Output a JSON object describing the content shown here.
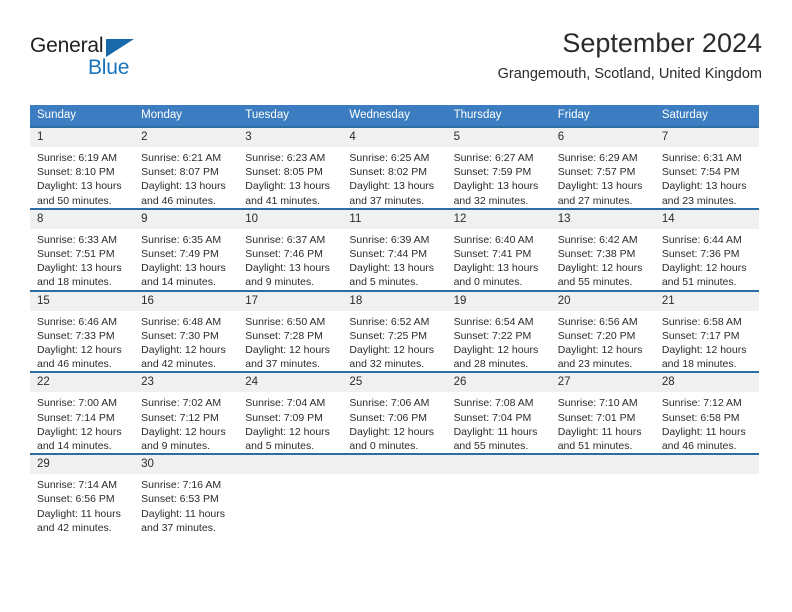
{
  "brand": {
    "name_part1": "General",
    "name_part2": "Blue",
    "color_dark": "#231f20",
    "color_blue": "#1b75bc"
  },
  "header": {
    "month_title": "September 2024",
    "location": "Grangemouth, Scotland, United Kingdom"
  },
  "theme": {
    "header_bar": "#3b7dc0",
    "week_rule": "#2e6da4",
    "daynum_band": "#f0f0f0",
    "text": "#2b2b2b"
  },
  "weekday_headers": [
    "Sunday",
    "Monday",
    "Tuesday",
    "Wednesday",
    "Thursday",
    "Friday",
    "Saturday"
  ],
  "weeks": [
    [
      {
        "day": "1",
        "sunrise": "Sunrise: 6:19 AM",
        "sunset": "Sunset: 8:10 PM",
        "daylight_l1": "Daylight: 13 hours",
        "daylight_l2": "and 50 minutes."
      },
      {
        "day": "2",
        "sunrise": "Sunrise: 6:21 AM",
        "sunset": "Sunset: 8:07 PM",
        "daylight_l1": "Daylight: 13 hours",
        "daylight_l2": "and 46 minutes."
      },
      {
        "day": "3",
        "sunrise": "Sunrise: 6:23 AM",
        "sunset": "Sunset: 8:05 PM",
        "daylight_l1": "Daylight: 13 hours",
        "daylight_l2": "and 41 minutes."
      },
      {
        "day": "4",
        "sunrise": "Sunrise: 6:25 AM",
        "sunset": "Sunset: 8:02 PM",
        "daylight_l1": "Daylight: 13 hours",
        "daylight_l2": "and 37 minutes."
      },
      {
        "day": "5",
        "sunrise": "Sunrise: 6:27 AM",
        "sunset": "Sunset: 7:59 PM",
        "daylight_l1": "Daylight: 13 hours",
        "daylight_l2": "and 32 minutes."
      },
      {
        "day": "6",
        "sunrise": "Sunrise: 6:29 AM",
        "sunset": "Sunset: 7:57 PM",
        "daylight_l1": "Daylight: 13 hours",
        "daylight_l2": "and 27 minutes."
      },
      {
        "day": "7",
        "sunrise": "Sunrise: 6:31 AM",
        "sunset": "Sunset: 7:54 PM",
        "daylight_l1": "Daylight: 13 hours",
        "daylight_l2": "and 23 minutes."
      }
    ],
    [
      {
        "day": "8",
        "sunrise": "Sunrise: 6:33 AM",
        "sunset": "Sunset: 7:51 PM",
        "daylight_l1": "Daylight: 13 hours",
        "daylight_l2": "and 18 minutes."
      },
      {
        "day": "9",
        "sunrise": "Sunrise: 6:35 AM",
        "sunset": "Sunset: 7:49 PM",
        "daylight_l1": "Daylight: 13 hours",
        "daylight_l2": "and 14 minutes."
      },
      {
        "day": "10",
        "sunrise": "Sunrise: 6:37 AM",
        "sunset": "Sunset: 7:46 PM",
        "daylight_l1": "Daylight: 13 hours",
        "daylight_l2": "and 9 minutes."
      },
      {
        "day": "11",
        "sunrise": "Sunrise: 6:39 AM",
        "sunset": "Sunset: 7:44 PM",
        "daylight_l1": "Daylight: 13 hours",
        "daylight_l2": "and 5 minutes."
      },
      {
        "day": "12",
        "sunrise": "Sunrise: 6:40 AM",
        "sunset": "Sunset: 7:41 PM",
        "daylight_l1": "Daylight: 13 hours",
        "daylight_l2": "and 0 minutes."
      },
      {
        "day": "13",
        "sunrise": "Sunrise: 6:42 AM",
        "sunset": "Sunset: 7:38 PM",
        "daylight_l1": "Daylight: 12 hours",
        "daylight_l2": "and 55 minutes."
      },
      {
        "day": "14",
        "sunrise": "Sunrise: 6:44 AM",
        "sunset": "Sunset: 7:36 PM",
        "daylight_l1": "Daylight: 12 hours",
        "daylight_l2": "and 51 minutes."
      }
    ],
    [
      {
        "day": "15",
        "sunrise": "Sunrise: 6:46 AM",
        "sunset": "Sunset: 7:33 PM",
        "daylight_l1": "Daylight: 12 hours",
        "daylight_l2": "and 46 minutes."
      },
      {
        "day": "16",
        "sunrise": "Sunrise: 6:48 AM",
        "sunset": "Sunset: 7:30 PM",
        "daylight_l1": "Daylight: 12 hours",
        "daylight_l2": "and 42 minutes."
      },
      {
        "day": "17",
        "sunrise": "Sunrise: 6:50 AM",
        "sunset": "Sunset: 7:28 PM",
        "daylight_l1": "Daylight: 12 hours",
        "daylight_l2": "and 37 minutes."
      },
      {
        "day": "18",
        "sunrise": "Sunrise: 6:52 AM",
        "sunset": "Sunset: 7:25 PM",
        "daylight_l1": "Daylight: 12 hours",
        "daylight_l2": "and 32 minutes."
      },
      {
        "day": "19",
        "sunrise": "Sunrise: 6:54 AM",
        "sunset": "Sunset: 7:22 PM",
        "daylight_l1": "Daylight: 12 hours",
        "daylight_l2": "and 28 minutes."
      },
      {
        "day": "20",
        "sunrise": "Sunrise: 6:56 AM",
        "sunset": "Sunset: 7:20 PM",
        "daylight_l1": "Daylight: 12 hours",
        "daylight_l2": "and 23 minutes."
      },
      {
        "day": "21",
        "sunrise": "Sunrise: 6:58 AM",
        "sunset": "Sunset: 7:17 PM",
        "daylight_l1": "Daylight: 12 hours",
        "daylight_l2": "and 18 minutes."
      }
    ],
    [
      {
        "day": "22",
        "sunrise": "Sunrise: 7:00 AM",
        "sunset": "Sunset: 7:14 PM",
        "daylight_l1": "Daylight: 12 hours",
        "daylight_l2": "and 14 minutes."
      },
      {
        "day": "23",
        "sunrise": "Sunrise: 7:02 AM",
        "sunset": "Sunset: 7:12 PM",
        "daylight_l1": "Daylight: 12 hours",
        "daylight_l2": "and 9 minutes."
      },
      {
        "day": "24",
        "sunrise": "Sunrise: 7:04 AM",
        "sunset": "Sunset: 7:09 PM",
        "daylight_l1": "Daylight: 12 hours",
        "daylight_l2": "and 5 minutes."
      },
      {
        "day": "25",
        "sunrise": "Sunrise: 7:06 AM",
        "sunset": "Sunset: 7:06 PM",
        "daylight_l1": "Daylight: 12 hours",
        "daylight_l2": "and 0 minutes."
      },
      {
        "day": "26",
        "sunrise": "Sunrise: 7:08 AM",
        "sunset": "Sunset: 7:04 PM",
        "daylight_l1": "Daylight: 11 hours",
        "daylight_l2": "and 55 minutes."
      },
      {
        "day": "27",
        "sunrise": "Sunrise: 7:10 AM",
        "sunset": "Sunset: 7:01 PM",
        "daylight_l1": "Daylight: 11 hours",
        "daylight_l2": "and 51 minutes."
      },
      {
        "day": "28",
        "sunrise": "Sunrise: 7:12 AM",
        "sunset": "Sunset: 6:58 PM",
        "daylight_l1": "Daylight: 11 hours",
        "daylight_l2": "and 46 minutes."
      }
    ],
    [
      {
        "day": "29",
        "sunrise": "Sunrise: 7:14 AM",
        "sunset": "Sunset: 6:56 PM",
        "daylight_l1": "Daylight: 11 hours",
        "daylight_l2": "and 42 minutes."
      },
      {
        "day": "30",
        "sunrise": "Sunrise: 7:16 AM",
        "sunset": "Sunset: 6:53 PM",
        "daylight_l1": "Daylight: 11 hours",
        "daylight_l2": "and 37 minutes."
      },
      {
        "day": "",
        "sunrise": "",
        "sunset": "",
        "daylight_l1": "",
        "daylight_l2": ""
      },
      {
        "day": "",
        "sunrise": "",
        "sunset": "",
        "daylight_l1": "",
        "daylight_l2": ""
      },
      {
        "day": "",
        "sunrise": "",
        "sunset": "",
        "daylight_l1": "",
        "daylight_l2": ""
      },
      {
        "day": "",
        "sunrise": "",
        "sunset": "",
        "daylight_l1": "",
        "daylight_l2": ""
      },
      {
        "day": "",
        "sunrise": "",
        "sunset": "",
        "daylight_l1": "",
        "daylight_l2": ""
      }
    ]
  ]
}
